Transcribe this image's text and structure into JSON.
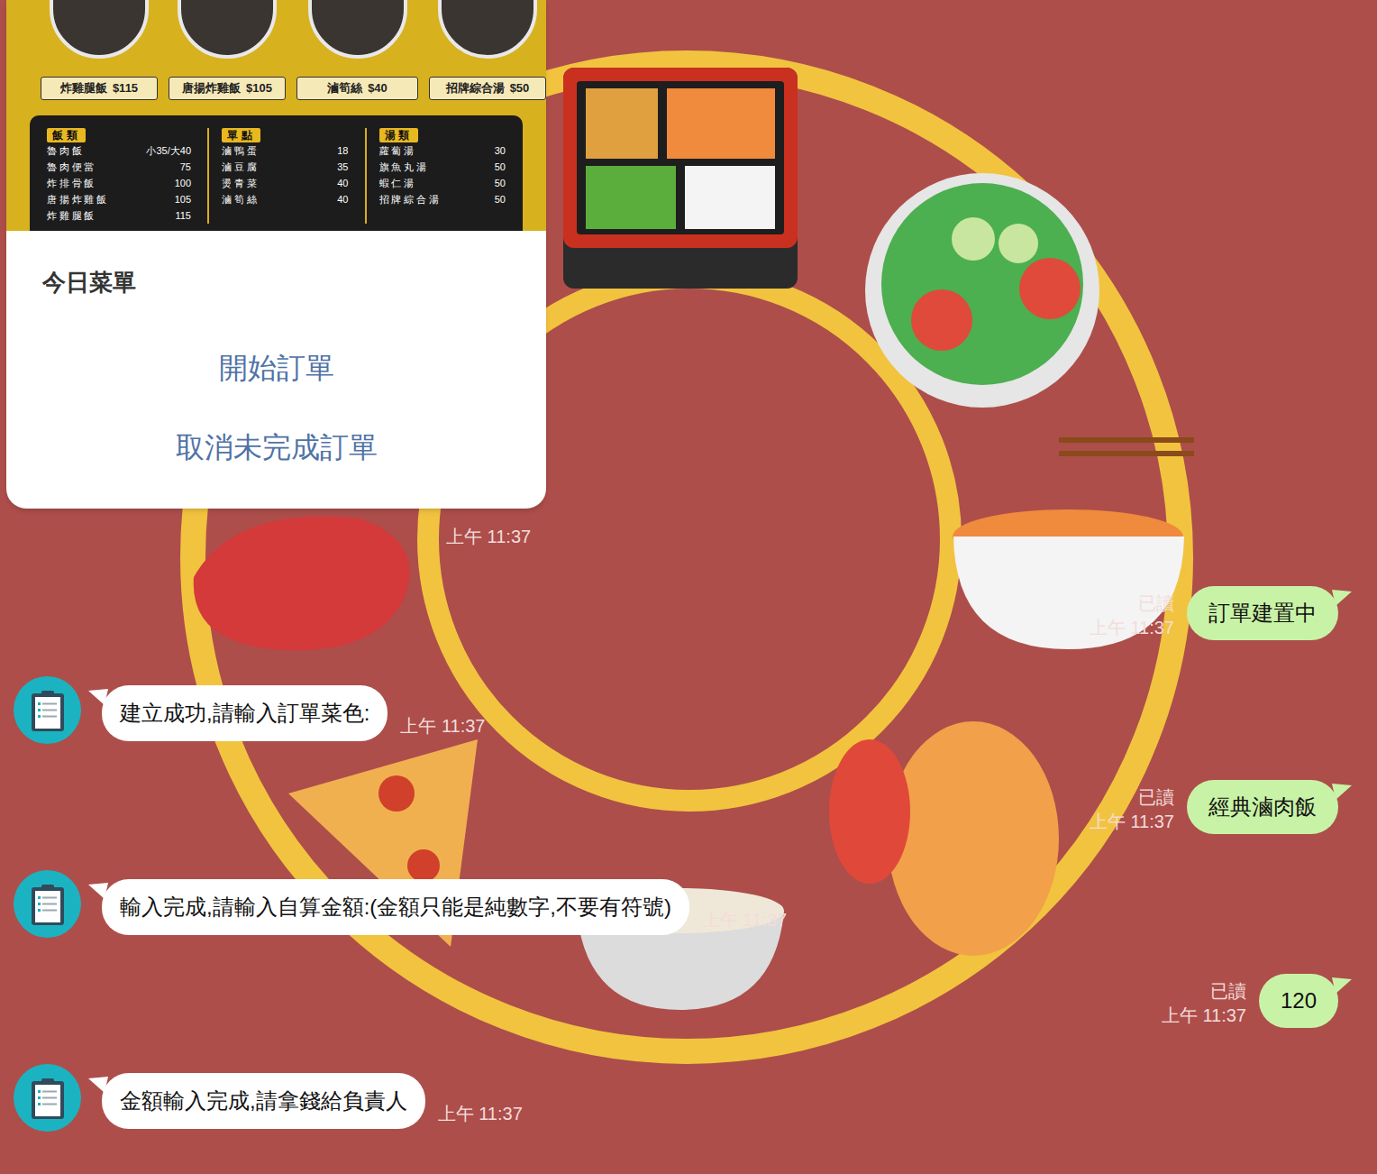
{
  "menu_card": {
    "image": {
      "featured": [
        {
          "name": "炸雞腿飯",
          "price": "$115"
        },
        {
          "name": "唐揚炸雞飯",
          "price": "$105"
        },
        {
          "name": "滷筍絲",
          "price": "$40"
        },
        {
          "name": "招牌綜合湯",
          "price": "$50"
        }
      ],
      "sections": [
        {
          "title": "飯類",
          "items": [
            {
              "name": "魯肉飯",
              "price": "小35/大40"
            },
            {
              "name": "魯肉便當",
              "price": "75"
            },
            {
              "name": "炸排骨飯",
              "price": "100"
            },
            {
              "name": "唐揚炸雞飯",
              "price": "105"
            },
            {
              "name": "炸雞腿飯",
              "price": "115"
            }
          ]
        },
        {
          "title": "單點",
          "items": [
            {
              "name": "滷鴨蛋",
              "price": "18"
            },
            {
              "name": "滷豆腐",
              "price": "35"
            },
            {
              "name": "燙青菜",
              "price": "40"
            },
            {
              "name": "滷筍絲",
              "price": "40"
            }
          ]
        },
        {
          "title": "湯類",
          "items": [
            {
              "name": "蘿蔔湯",
              "price": "30"
            },
            {
              "name": "旗魚丸湯",
              "price": "50"
            },
            {
              "name": "蝦仁湯",
              "price": "50"
            },
            {
              "name": "招牌綜合湯",
              "price": "50"
            }
          ]
        }
      ]
    },
    "title": "今日菜單",
    "actions": [
      "開始訂單",
      "取消未完成訂單"
    ],
    "time": "上午 11:37"
  },
  "messages": [
    {
      "kind": "user",
      "text": "訂單建置中",
      "read": "已讀",
      "time": "上午 11:37"
    },
    {
      "kind": "bot",
      "text": "建立成功,請輸入訂單菜色:",
      "time": "上午 11:37"
    },
    {
      "kind": "user",
      "text": "經典滷肉飯",
      "read": "已讀",
      "time": "上午 11:37"
    },
    {
      "kind": "bot",
      "text": "輸入完成,請輸入自算金額:(金額只能是純數字,不要有符號)",
      "time": "上午 11:37"
    },
    {
      "kind": "user",
      "text": "120",
      "read": "已讀",
      "time": "上午 11:37"
    },
    {
      "kind": "bot",
      "text": "金額輸入完成,請拿錢給負責人",
      "time": "上午 11:37"
    }
  ]
}
